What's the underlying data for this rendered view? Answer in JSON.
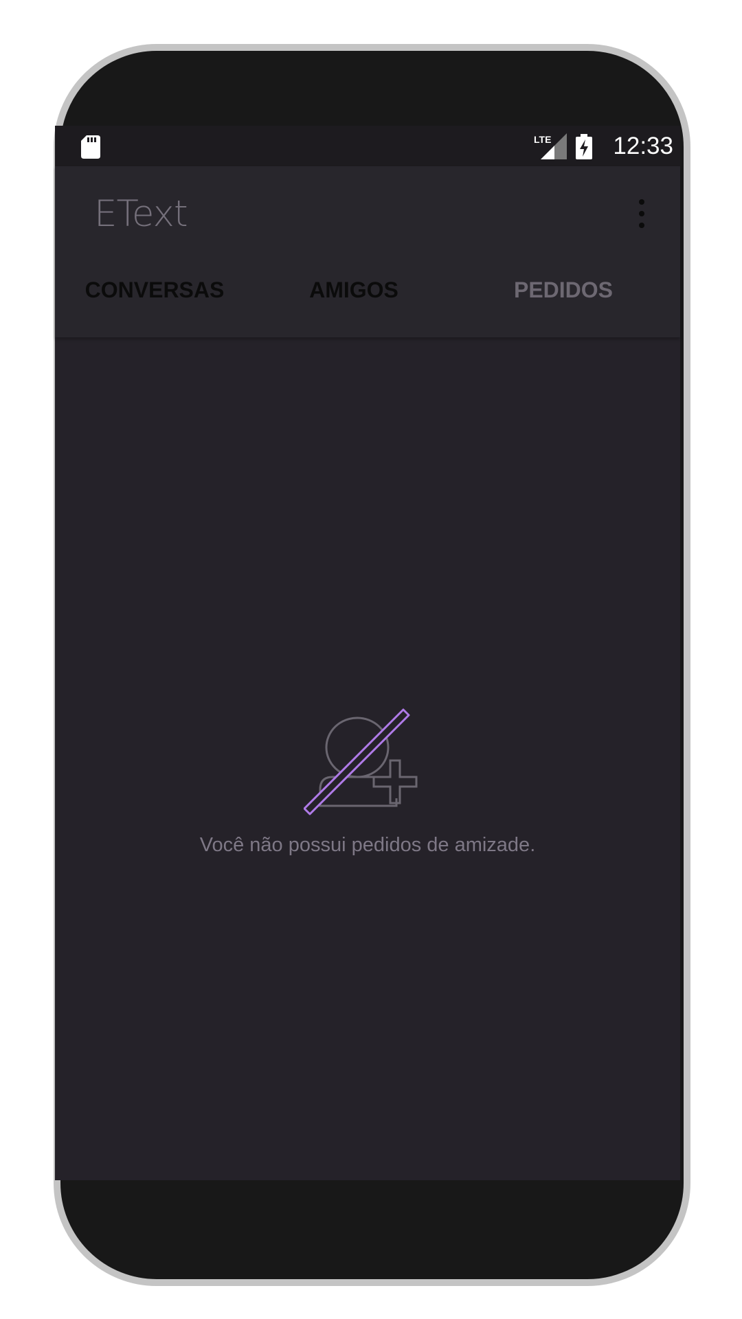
{
  "status_bar": {
    "time": "12:33",
    "network_label": "LTE",
    "icons": [
      "sd-card-icon",
      "lte-signal-icon",
      "battery-charging-icon"
    ]
  },
  "app_bar": {
    "title": "EText",
    "menu_icon": "more-vert-icon"
  },
  "tabs": [
    {
      "label": "CONVERSAS",
      "selected": false
    },
    {
      "label": "AMIGOS",
      "selected": false
    },
    {
      "label": "PEDIDOS",
      "selected": true
    }
  ],
  "empty_state": {
    "icon": "no-friend-requests-icon",
    "message": "Você não possui pedidos de amizade."
  },
  "colors": {
    "background": "#252229",
    "app_bar": "#28262c",
    "status_bar": "#1d1b1f",
    "accent": "#b07be8",
    "muted_text": "#7e7886",
    "tab_inactive": "#0b0b0b",
    "tab_active": "#6d6872"
  }
}
